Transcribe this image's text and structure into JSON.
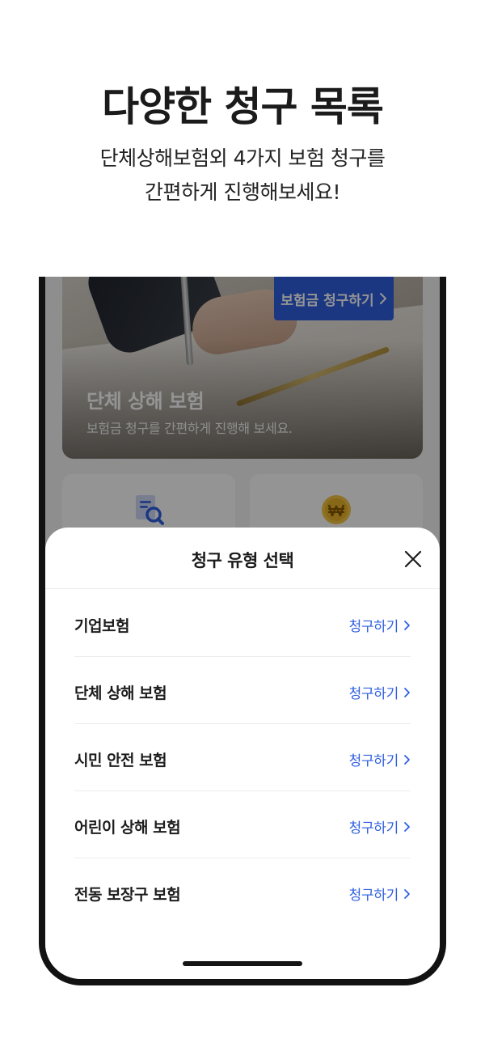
{
  "promo": {
    "title": "다양한 청구 목록",
    "subtitle_line1": "단체상해보험외 4가지 보험 청구를",
    "subtitle_line2": "간편하게 진행해보세요!"
  },
  "banner": {
    "button_label": "보험금 청구하기",
    "title": "단체 상해 보험",
    "description": "보험금 청구를 간편하게 진행해 보세요.",
    "accent_color": "#2f5fe0"
  },
  "quick_cards": [
    {
      "icon": "document-search-icon"
    },
    {
      "icon": "won-coin-icon"
    }
  ],
  "sheet": {
    "title": "청구 유형 선택",
    "close_icon": "close-icon",
    "items": [
      {
        "label": "기업보험",
        "action": "청구하기"
      },
      {
        "label": "단체 상해 보험",
        "action": "청구하기"
      },
      {
        "label": "시민 안전 보험",
        "action": "청구하기"
      },
      {
        "label": "어린이 상해 보험",
        "action": "청구하기"
      },
      {
        "label": "전동 보장구 보험",
        "action": "청구하기"
      }
    ],
    "action_color": "#2f5fe0"
  }
}
